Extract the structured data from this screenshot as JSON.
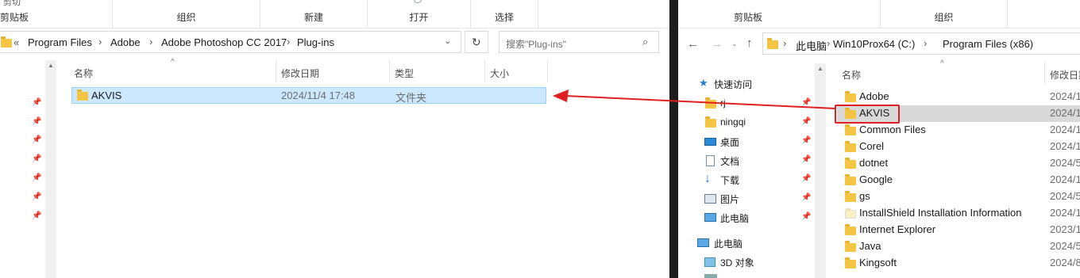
{
  "left": {
    "ribbon": {
      "cut_label": "剪切",
      "groups": [
        "剪贴板",
        "组织",
        "新建",
        "打开",
        "选择"
      ]
    },
    "address": {
      "breadcrumbs": [
        "Program Files",
        "Adobe",
        "Adobe Photoshop CC 2017",
        "Plug-ins"
      ],
      "overflow": "«"
    },
    "search": {
      "placeholder": "搜索\"Plug-ins\""
    },
    "columns": [
      "名称",
      "修改日期",
      "类型",
      "大小"
    ],
    "rows": [
      {
        "name": "AKVIS",
        "date": "2024/11/4 17:48",
        "type": "文件夹",
        "size": ""
      }
    ]
  },
  "right": {
    "ribbon": {
      "groups": [
        "剪贴板",
        "组织"
      ]
    },
    "address": {
      "breadcrumbs": [
        "此电脑",
        "Win10Prox64 (C:)",
        "Program Files (x86)"
      ]
    },
    "nav": {
      "quick_access": "快速访问",
      "items": [
        {
          "label": "rj",
          "icon": "folder-icon"
        },
        {
          "label": "ningqi",
          "icon": "folder-icon"
        },
        {
          "label": "桌面",
          "icon": "desktop-icon"
        },
        {
          "label": "文档",
          "icon": "documents-icon"
        },
        {
          "label": "下载",
          "icon": "download-icon"
        },
        {
          "label": "图片",
          "icon": "pictures-icon"
        },
        {
          "label": "此电脑",
          "icon": "computer-icon"
        }
      ],
      "this_pc": "此电脑",
      "objects_3d": "3D 对象"
    },
    "columns": [
      "名称",
      "修改日期"
    ],
    "rows": [
      {
        "name": "Adobe",
        "date": "2024/1"
      },
      {
        "name": "AKVIS",
        "date": "2024/1"
      },
      {
        "name": "Common Files",
        "date": "2024/1"
      },
      {
        "name": "Corel",
        "date": "2024/1"
      },
      {
        "name": "dotnet",
        "date": "2024/5"
      },
      {
        "name": "Google",
        "date": "2024/1"
      },
      {
        "name": "gs",
        "date": "2024/5"
      },
      {
        "name": "InstallShield Installation Information",
        "date": "2024/1"
      },
      {
        "name": "Internet Explorer",
        "date": "2023/1"
      },
      {
        "name": "Java",
        "date": "2024/5"
      },
      {
        "name": "Kingsoft",
        "date": "2024/8"
      }
    ]
  },
  "colors": {
    "selection": "#cce8ff",
    "selection_border": "#99d1ff",
    "highlight_box": "#e02020",
    "arrow": "#e02020",
    "hover_row": "#d9d9d9"
  }
}
